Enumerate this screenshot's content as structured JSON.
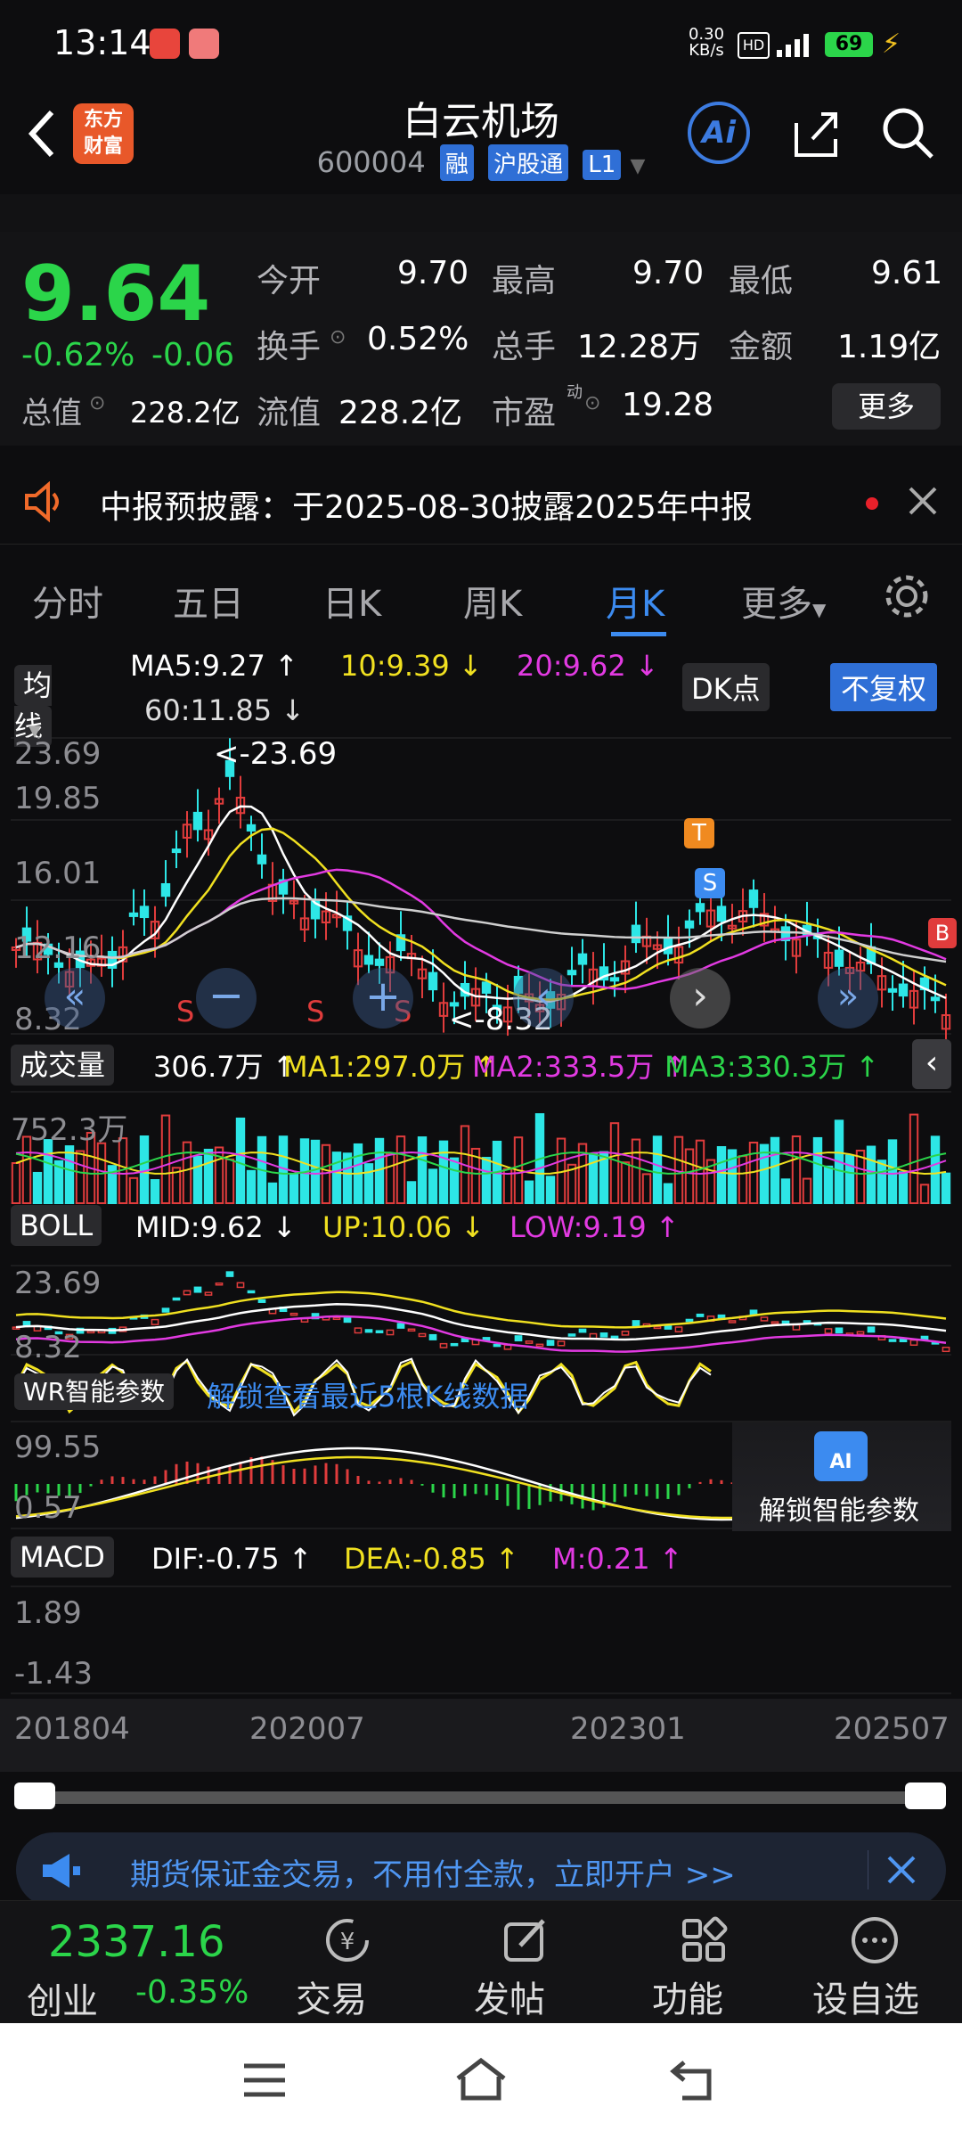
{
  "status_bar": {
    "time": "13:14",
    "net_speed": "0.30 KB/s",
    "battery": "69"
  },
  "header": {
    "title": "白云机场",
    "code": "600004",
    "tags": [
      "融",
      "沪股通",
      "L1"
    ],
    "ai_label": "Ai",
    "brand_lines": [
      "东方",
      "财富"
    ]
  },
  "quote": {
    "price": "9.64",
    "change_pct": "-0.62%",
    "change_abs": "-0.06",
    "total_value_label": "总值",
    "total_value": "228.2亿",
    "fields": [
      {
        "label": "今开",
        "value": "9.70"
      },
      {
        "label": "最高",
        "value": "9.70"
      },
      {
        "label": "最低",
        "value": "9.61"
      },
      {
        "label": "换手",
        "value": "0.52%"
      },
      {
        "label": "总手",
        "value": "12.28万"
      },
      {
        "label": "金额",
        "value": "1.19亿"
      },
      {
        "label": "流值",
        "value": "228.2亿"
      },
      {
        "label": "市盈",
        "value": "19.28"
      }
    ],
    "more_button": "更多",
    "pe_superscript": "动"
  },
  "news": {
    "text": "中报预披露：于2025-08-30披露2025年中报"
  },
  "tabs": [
    "分时",
    "五日",
    "日K",
    "周K",
    "月K",
    "更多"
  ],
  "active_tab": "月K",
  "ma_panel": {
    "selector": "均线",
    "ma5": "MA5:9.27 ↑",
    "ma10": "10:9.39 ↓",
    "ma20": "20:9.62 ↓",
    "ma60": "60:11.85 ↓",
    "dk_label": "DK点",
    "fq_label": "不复权",
    "y_top": "23.69",
    "y_2": "19.85",
    "y_3": "16.01",
    "y_4": "12.16",
    "y_bottom": "8.32",
    "max_marker": "<-23.69",
    "min_marker": "<-8.32",
    "signal_t": "T",
    "signal_s": "S",
    "signal_b": "B",
    "s_markers": [
      "S",
      "S",
      "S"
    ]
  },
  "volume_panel": {
    "selector": "成交量",
    "current": "306.7万 ↑",
    "ma1": "MA1:297.0万 ↑",
    "ma2": "MA2:333.5万 ↑",
    "ma3": "MA3:330.3万 ↑",
    "y_label": "752.3万"
  },
  "boll_panel": {
    "selector": "BOLL",
    "mid": "MID:9.62 ↓",
    "up": "UP:10.06 ↓",
    "low": "LOW:9.19 ↑",
    "y_top": "23.69",
    "y_bottom": "8.32"
  },
  "wr_panel": {
    "selector": "WR智能参数",
    "unlock_text": "解锁查看最近5根K线数据",
    "y_top": "99.55",
    "y_bottom": "0.57",
    "unlock_button": "解锁智能参数",
    "ai_badge": "AI"
  },
  "macd_panel": {
    "selector": "MACD",
    "dif": "DIF:-0.75 ↑",
    "dea": "DEA:-0.85 ↑",
    "m": "M:0.21 ↑",
    "y_top": "1.89",
    "y_bottom": "-1.43"
  },
  "x_axis": [
    "201804",
    "202007",
    "202301",
    "202507"
  ],
  "promo": {
    "text": "期货保证金交易，不用付全款，立即开户 >>"
  },
  "bottom_bar": {
    "index_value": "2337.16",
    "index_name": "创业",
    "index_change": "-0.35%",
    "items": [
      "交易",
      "发帖",
      "功能",
      "设自选"
    ]
  },
  "colors": {
    "up": "#e03c3c",
    "down": "#2de6e6",
    "price_down": "#2bd54a",
    "ma5": "#ffffff",
    "ma10": "#f0e020",
    "ma20": "#e23ae2",
    "ma60": "#cfcfcf",
    "accent": "#2f6fd6"
  }
}
